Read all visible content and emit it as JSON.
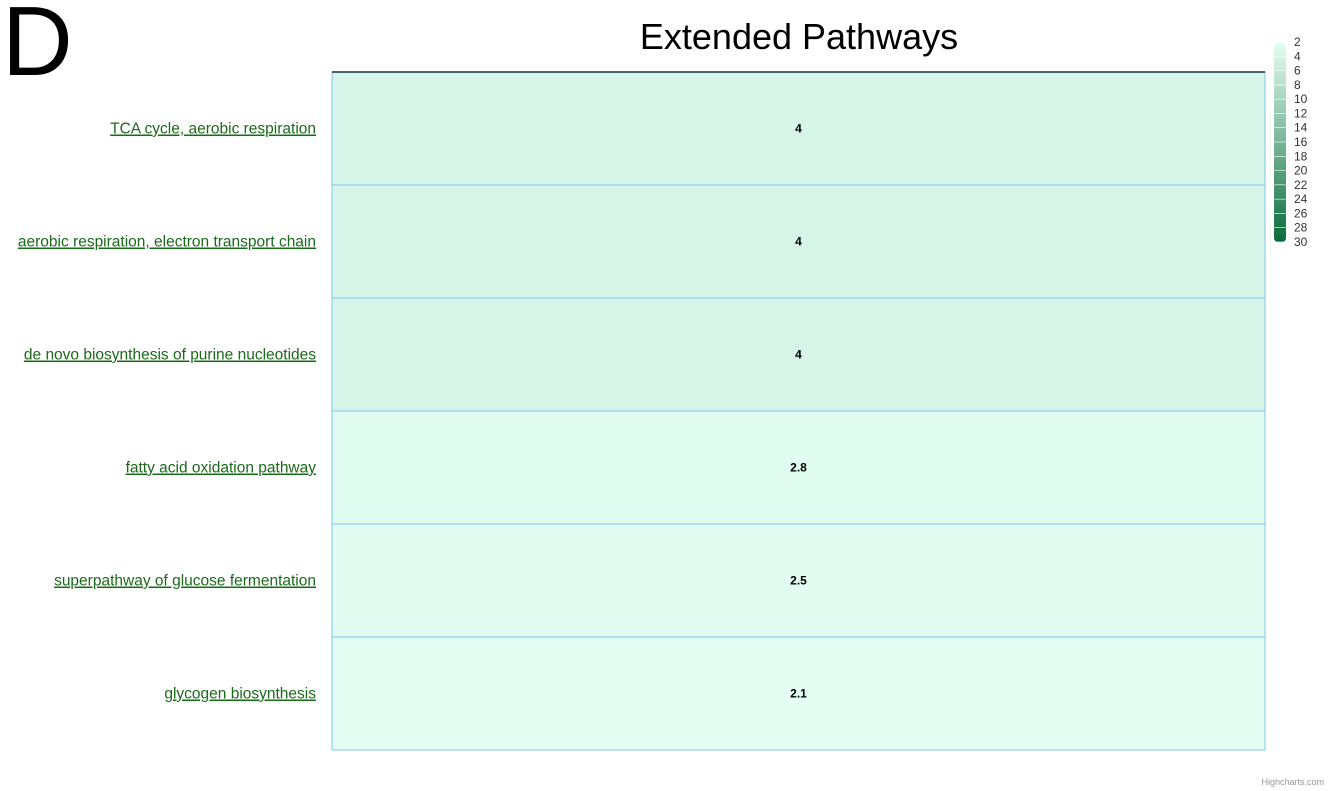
{
  "panel_letter": "D",
  "credits": "Highcharts.com",
  "chart_data": {
    "type": "heatmap",
    "title": "Extended Pathways",
    "xlabel": "",
    "ylabel": "",
    "categories": [
      "TCA cycle, aerobic respiration",
      "aerobic respiration, electron transport chain",
      "de novo biosynthesis of purine nucleotides",
      "fatty acid oxidation pathway",
      "superpathway of glucose fermentation",
      "glycogen biosynthesis"
    ],
    "values": [
      4,
      4,
      4,
      2.8,
      2.5,
      2.1
    ],
    "value_labels": [
      "4",
      "4",
      "4",
      "2.8",
      "2.5",
      "2.1"
    ],
    "color_axis": {
      "min": 2,
      "max": 30,
      "min_color": "#e6fff4",
      "max_color": "#0a6b3c",
      "tick_labels": [
        "2",
        "4",
        "6",
        "8",
        "10",
        "12",
        "14",
        "16",
        "18",
        "20",
        "22",
        "24",
        "26",
        "28",
        "30"
      ],
      "legend_position": "top-right"
    },
    "grid_color": "#7cc8ee",
    "label_color": "#1b6a1b"
  }
}
